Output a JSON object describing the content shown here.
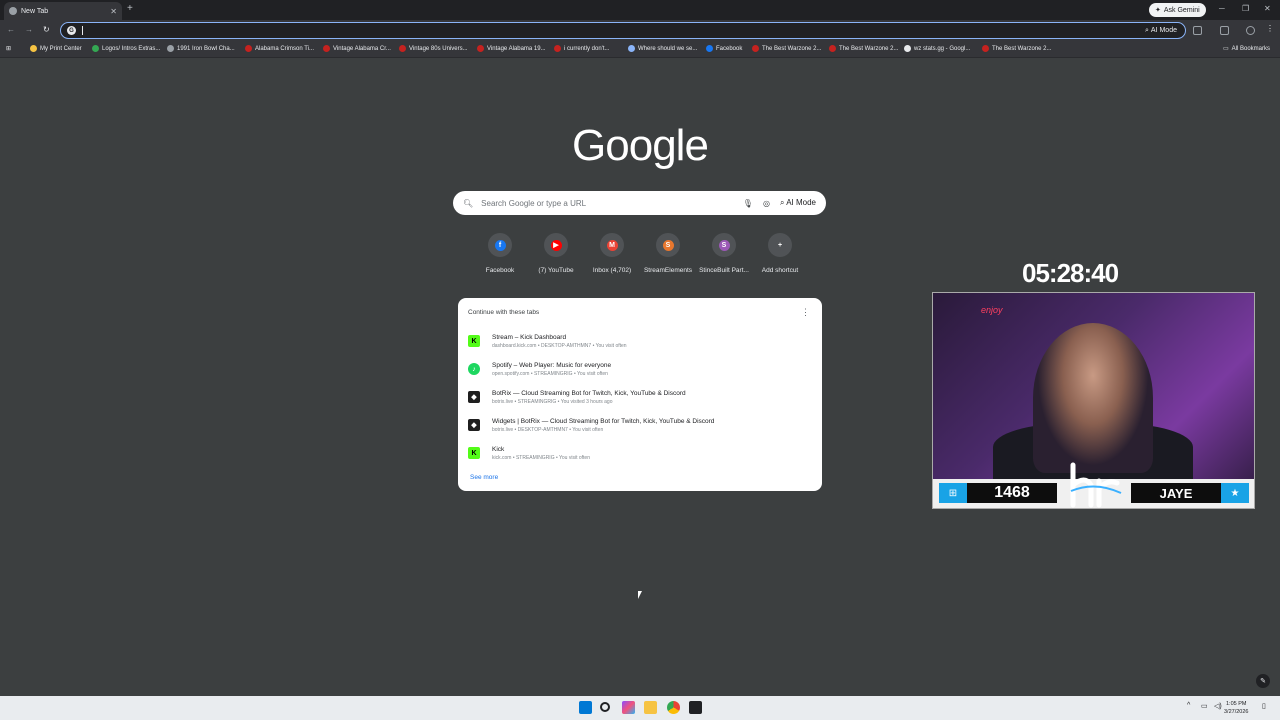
{
  "browser": {
    "tab_title": "New Tab",
    "new_tab_symbol": "+",
    "ask_gemini": "Ask Gemini",
    "omnibox_ai_mode": "AI Mode",
    "all_bookmarks": "All Bookmarks"
  },
  "bookmarks": [
    {
      "label": "My Print Center",
      "color": "#f6c343"
    },
    {
      "label": "Logos/ Intros Extras...",
      "color": "#34a853"
    },
    {
      "label": "1991 Iron Bowl Cha...",
      "color": "#9aa0a6"
    },
    {
      "label": "Alabama Crimson Ti...",
      "color": "#c5221f"
    },
    {
      "label": "Vintage Alabama Cr...",
      "color": "#c5221f"
    },
    {
      "label": "Vintage 80s Univers...",
      "color": "#c5221f"
    },
    {
      "label": "Vintage Alabama 19...",
      "color": "#c5221f"
    },
    {
      "label": "i currently don't...",
      "color": "#c5221f"
    },
    {
      "label": "Where should we se...",
      "color": "#8ab4f8"
    },
    {
      "label": "Facebook",
      "color": "#1877f2"
    },
    {
      "label": "The Best Warzone 2...",
      "color": "#c5221f"
    },
    {
      "label": "The Best Warzone 2...",
      "color": "#c5221f"
    },
    {
      "label": "wz stats.gg - Googl...",
      "color": "#e8eaed"
    },
    {
      "label": "The Best Warzone 2...",
      "color": "#c5221f"
    }
  ],
  "newtab": {
    "logo": "Google",
    "search_placeholder": "Search Google or type a URL",
    "ai_mode": "AI Mode",
    "shortcuts": [
      {
        "label": "Facebook",
        "letter": "f",
        "color": "#1877f2"
      },
      {
        "label": "(7) YouTube",
        "letter": "▶",
        "color": "#ff0000"
      },
      {
        "label": "Inbox (4,702)",
        "letter": "M",
        "color": "#ea4335"
      },
      {
        "label": "StreamElements",
        "letter": "S",
        "color": "#e8772e"
      },
      {
        "label": "StinceBuilt Part...",
        "letter": "S",
        "color": "#9b59b6"
      },
      {
        "label": "Add shortcut",
        "letter": "+",
        "color": "#505356"
      }
    ],
    "continue_card": {
      "heading": "Continue with these tabs",
      "items": [
        {
          "title": "Stream – Kick Dashboard",
          "sub": "dashboard.kick.com • DESKTOP-AMTHMN7 • You visit often",
          "icon": "K",
          "bg": "#53fc18",
          "fg": "#000000"
        },
        {
          "title": "Spotify – Web Player: Music for everyone",
          "sub": "open.spotify.com • STREAMINGRIG • You visit often",
          "icon": "♪",
          "bg": "#1ed760",
          "fg": "#ffffff"
        },
        {
          "title": "BotRix — Cloud Streaming Bot for Twitch, Kick, YouTube & Discord",
          "sub": "botrix.live • STREAMINGRIG • You visited 3 hours ago",
          "icon": "◆",
          "bg": "#1f1f1f",
          "fg": "#ffffff"
        },
        {
          "title": "Widgets | BotRix — Cloud Streaming Bot for Twitch, Kick, YouTube & Discord",
          "sub": "botrix.live • DESKTOP-AMTHMN7 • You visit often",
          "icon": "◆",
          "bg": "#1f1f1f",
          "fg": "#ffffff"
        },
        {
          "title": "Kick",
          "sub": "kick.com • STREAMINGRIG • You visit often",
          "icon": "K",
          "bg": "#53fc18",
          "fg": "#000000"
        }
      ],
      "see_more": "See more"
    }
  },
  "overlay": {
    "timer": "05:28:40",
    "count": "1468",
    "name": "JAYE",
    "neon_text": "enjoy"
  },
  "taskbar": {
    "time": "1:05 PM",
    "date": "3/27/2026"
  }
}
